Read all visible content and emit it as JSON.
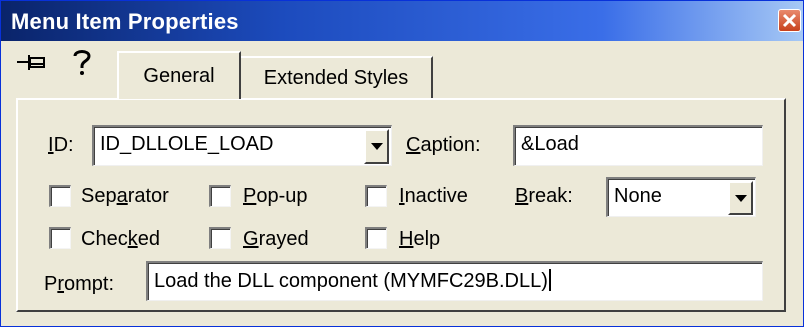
{
  "window": {
    "title": "Menu Item Properties",
    "close_label": "close"
  },
  "tabs": [
    {
      "label": "General",
      "active": true
    },
    {
      "label": "Extended Styles",
      "active": false
    }
  ],
  "form": {
    "id": {
      "label_u": "I",
      "label_rest": "D:",
      "value": "ID_DLLOLE_LOAD"
    },
    "caption": {
      "label_u": "C",
      "label_rest": "aption:",
      "value": "&Load"
    },
    "checkboxes": {
      "separator": {
        "pre": "Sep",
        "u": "a",
        "post": "rator",
        "checked": false
      },
      "popup": {
        "pre": "",
        "u": "P",
        "post": "op-up",
        "checked": false
      },
      "inactive": {
        "pre": "",
        "u": "I",
        "post": "nactive",
        "checked": false
      },
      "checked": {
        "pre": "Chec",
        "u": "k",
        "post": "ed",
        "checked": false
      },
      "grayed": {
        "pre": "",
        "u": "G",
        "post": "rayed",
        "checked": false
      },
      "help": {
        "pre": "",
        "u": "H",
        "post": "elp",
        "checked": false
      }
    },
    "break": {
      "label_u": "B",
      "label_rest": "reak:",
      "value": "None"
    },
    "prompt": {
      "label_pre": "P",
      "label_u": "r",
      "label_rest": "ompt:",
      "value": "Load the DLL component (MYMFC29B.DLL)"
    }
  },
  "colors": {
    "title_bar": "#0a246a",
    "dialog_bg": "#ece9d8",
    "close_button": "#c8411d"
  },
  "icons": [
    "pin-icon",
    "help-icon",
    "close-icon",
    "dropdown-arrow-icon"
  ]
}
